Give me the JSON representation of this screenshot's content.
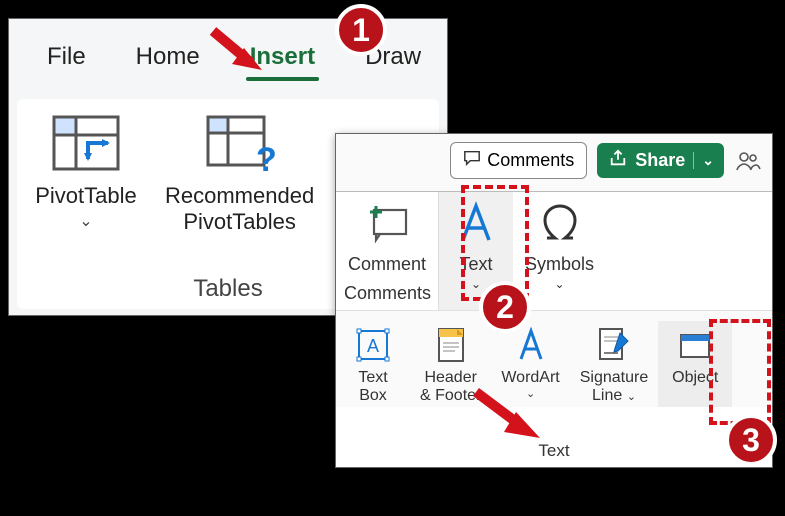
{
  "tabs": {
    "file": "File",
    "home": "Home",
    "insert": "Insert",
    "draw": "Draw"
  },
  "tablesGroup": {
    "pivotTable": "PivotTable",
    "recommendedPivotTables_line1": "Recommended",
    "recommendedPivotTables_line2": "PivotTables",
    "groupLabel": "Tables"
  },
  "topbar": {
    "comments": "Comments",
    "share": "Share"
  },
  "commentsGroup": {
    "comment": "Comment",
    "text": "Text",
    "symbols": "Symbols",
    "groupLabel": "Comments"
  },
  "textGroup": {
    "textBox_line1": "Text",
    "textBox_line2": "Box",
    "headerFooter_line1": "Header",
    "headerFooter_line2": "& Footer",
    "wordArt": "WordArt",
    "signatureLine_line1": "Signature",
    "signatureLine_line2": "Line",
    "object": "Object",
    "groupLabel": "Text"
  },
  "annotation": {
    "n1": "1",
    "n2": "2",
    "n3": "3"
  }
}
